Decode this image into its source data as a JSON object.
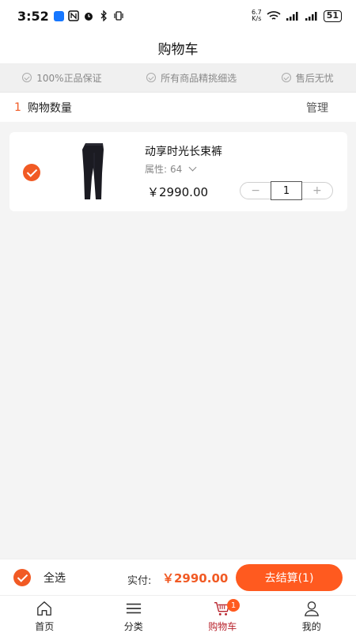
{
  "status_bar": {
    "time": "3:52",
    "speed_top": "6.7",
    "speed_bottom": "K/s",
    "battery": "51",
    "icons": [
      "app-icon",
      "nfc-icon",
      "alarm-icon",
      "bluetooth-icon",
      "vibrate-icon",
      "wifi-icon",
      "signal-icon",
      "signal-icon",
      "battery-icon"
    ]
  },
  "header": {
    "title": "购物车"
  },
  "guarantees": [
    {
      "label": "100%正品保证"
    },
    {
      "label": "所有商品精挑细选"
    },
    {
      "label": "售后无忧"
    }
  ],
  "count_row": {
    "count": "1",
    "label": "购物数量",
    "manage": "管理"
  },
  "cart_items": [
    {
      "checked": true,
      "title": "动享时光长束裤",
      "attr_label": "属性:",
      "attr_value": "64",
      "price": "￥2990.00",
      "quantity": "1",
      "minus": "−",
      "plus": "+"
    }
  ],
  "checkout": {
    "select_all": "全选",
    "paid_label": "实付:",
    "paid_amount": "￥2990.00",
    "button": "去结算(1)"
  },
  "tabs": [
    {
      "label": "首页",
      "icon": "home-icon",
      "active": false
    },
    {
      "label": "分类",
      "icon": "menu-icon",
      "active": false
    },
    {
      "label": "购物车",
      "icon": "cart-icon",
      "active": true,
      "badge": "1"
    },
    {
      "label": "我的",
      "icon": "user-icon",
      "active": false
    }
  ],
  "colors": {
    "accent": "#f15a24",
    "button": "#ff5a1f",
    "active_tab": "#b8232c"
  }
}
